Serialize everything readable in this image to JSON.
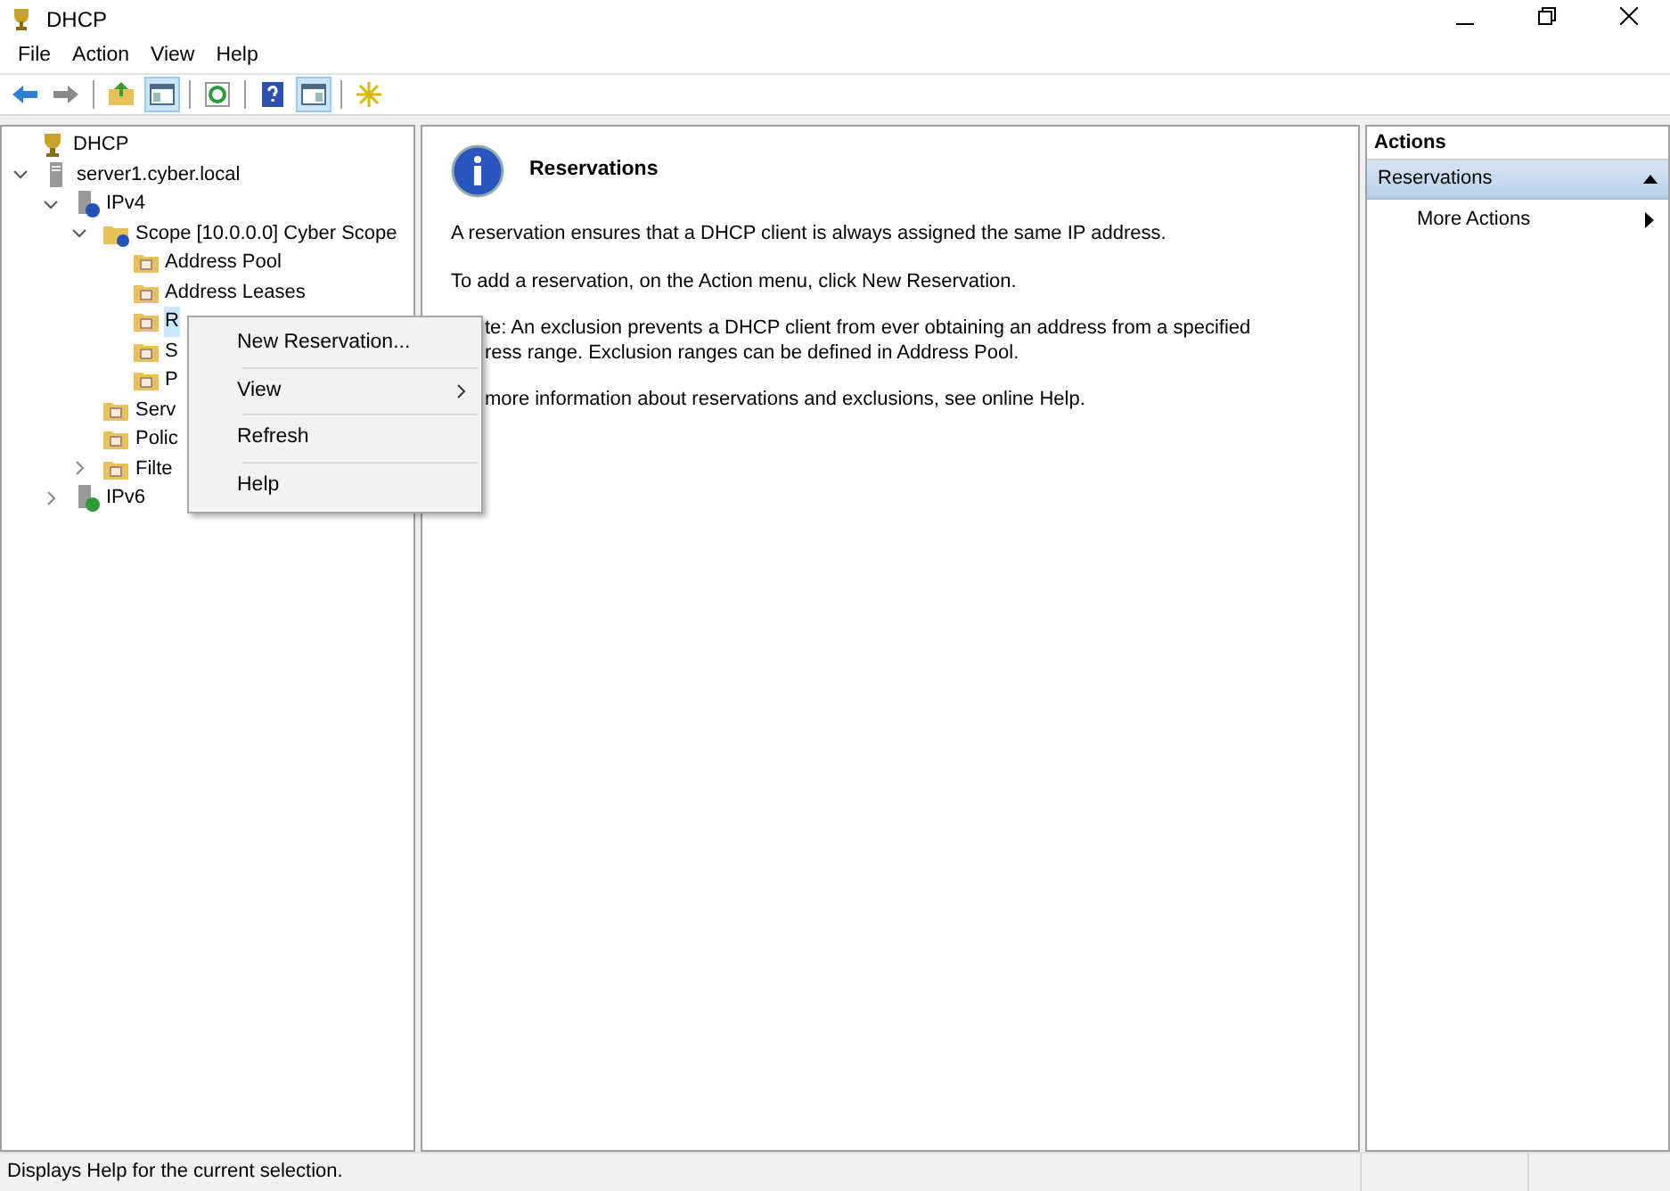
{
  "window": {
    "title": "DHCP"
  },
  "menu_bar": [
    "File",
    "Action",
    "View",
    "Help"
  ],
  "toolbar": [
    {
      "kind": "back"
    },
    {
      "kind": "forward"
    },
    {
      "kind": "sep"
    },
    {
      "kind": "up"
    },
    {
      "kind": "pane",
      "selected": true
    },
    {
      "kind": "sep"
    },
    {
      "kind": "refresh"
    },
    {
      "kind": "sep"
    },
    {
      "kind": "help"
    },
    {
      "kind": "pane2",
      "selected": true
    },
    {
      "kind": "sep"
    },
    {
      "kind": "star"
    }
  ],
  "tree": [
    {
      "label": "DHCP",
      "kind": "dhcp",
      "selected": false,
      "children": [
        {
          "label": "server1.cyber.local",
          "kind": "server",
          "expanded": true,
          "selected": false,
          "children": [
            {
              "label": "IPv4",
              "kind": "ipv4",
              "expanded": true,
              "selected": false,
              "children": [
                {
                  "label": "Scope [10.0.0.0] Cyber Scope",
                  "kind": "scope",
                  "expanded": true,
                  "selected": false,
                  "children": [
                    {
                      "label": "Address Pool",
                      "kind": "folder",
                      "selected": false
                    },
                    {
                      "label": "Address Leases",
                      "kind": "folder",
                      "selected": false
                    },
                    {
                      "label": "R",
                      "kind": "folder",
                      "selected": true
                    },
                    {
                      "label": "S",
                      "kind": "folder",
                      "selected": false
                    },
                    {
                      "label": "P",
                      "kind": "folder",
                      "selected": false
                    }
                  ]
                },
                {
                  "label": "Serv",
                  "kind": "folder",
                  "selected": false
                },
                {
                  "label": "Polic",
                  "kind": "folder",
                  "selected": false
                },
                {
                  "label": "Filte",
                  "kind": "folder",
                  "expanded": false,
                  "selected": false
                }
              ]
            },
            {
              "label": "IPv6",
              "kind": "ipv6",
              "expanded": false,
              "selected": false
            }
          ]
        }
      ]
    }
  ],
  "context_menu": [
    {
      "label": "New Reservation...",
      "submenu": false
    },
    {
      "label": "View",
      "submenu": true
    },
    {
      "label": "Refresh",
      "submenu": false
    },
    {
      "label": "Help",
      "submenu": false
    }
  ],
  "content": {
    "heading": "Reservations",
    "paragraphs": [
      {
        "lines": [
          {
            "text": "A reservation ensures that a DHCP client is always assigned the same IP address.",
            "covered": false
          }
        ]
      },
      {
        "lines": [
          {
            "text": "To add a reservation, on the Action menu, click New Reservation.",
            "covered": false
          }
        ]
      },
      {
        "lines": [
          {
            "text": "te: An exclusion prevents a DHCP client from ever obtaining an address from a specified",
            "covered": true
          },
          {
            "text": "ress range.  Exclusion ranges can be defined in Address Pool.",
            "covered": true
          }
        ]
      },
      {
        "lines": [
          {
            "text": "more information about reservations and exclusions, see online Help.",
            "covered": true
          }
        ]
      }
    ]
  },
  "actions": {
    "title": "Actions",
    "section": "Reservations",
    "items": [
      "More Actions"
    ]
  },
  "status_bar": "Displays Help for the current selection."
}
